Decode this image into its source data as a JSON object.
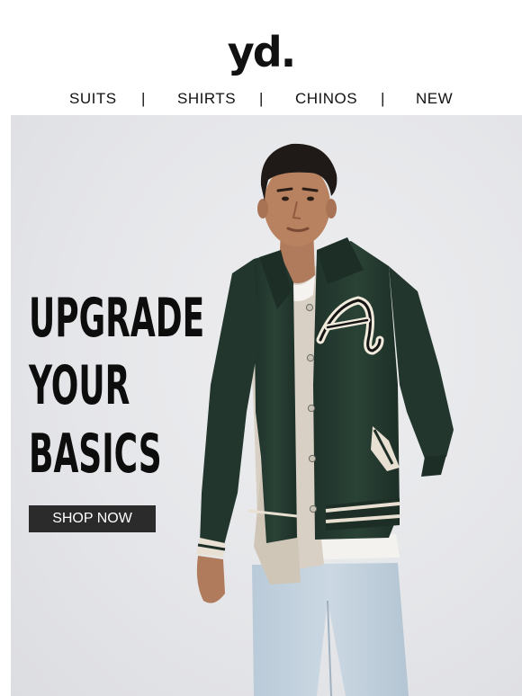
{
  "brand": {
    "logo_text": "yd."
  },
  "nav": {
    "items": [
      {
        "label": "SUITS"
      },
      {
        "label": "SHIRTS"
      },
      {
        "label": "CHINOS"
      },
      {
        "label": "NEW"
      }
    ],
    "separator": "|"
  },
  "hero": {
    "headline_lines": [
      "UPGRADE",
      "YOUR",
      "BASICS"
    ],
    "cta_label": "SHOP NOW",
    "jacket_letter": "A"
  },
  "colors": {
    "headline": "#0d0d0d",
    "cta_background": "#2b2b2b",
    "jacket": "#263b30"
  }
}
